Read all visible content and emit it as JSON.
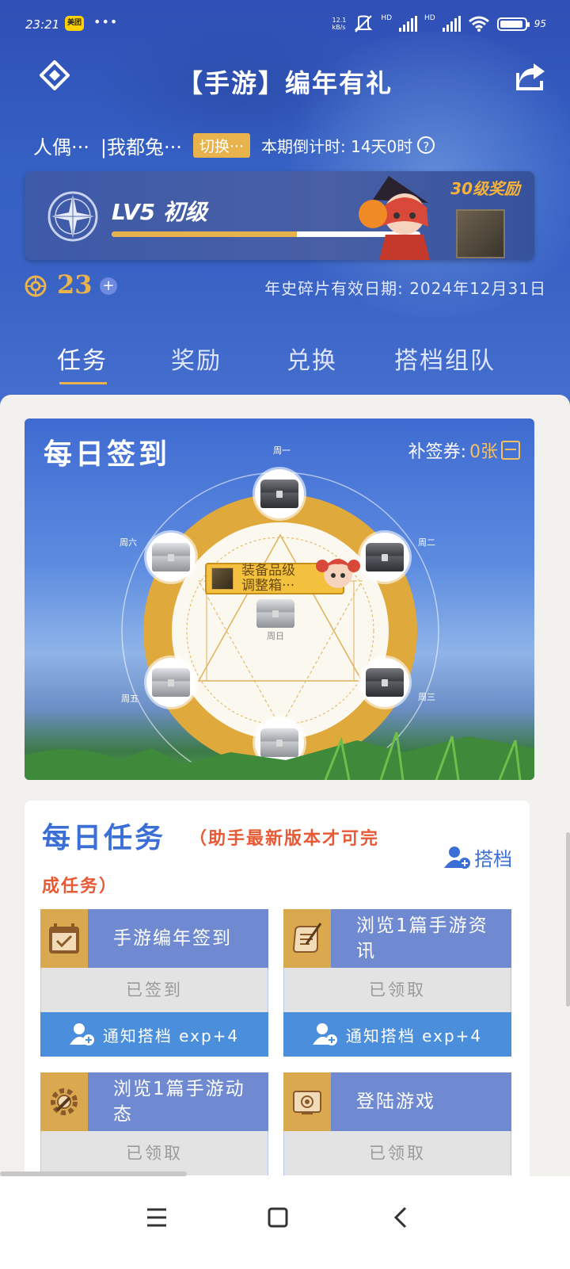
{
  "status_bar": {
    "time": "23:21",
    "app_badge": "美团",
    "dots": "•••",
    "speed": "12.1\nkB/s",
    "sig1": "HD",
    "sig2": "HD",
    "battery": "95"
  },
  "header": {
    "title": "【手游】编年有礼"
  },
  "user": {
    "character": "人偶···",
    "server": "|我都兔···",
    "switch_label": "切换···",
    "countdown": "本期倒计时: 14天0时",
    "help": "?"
  },
  "level": {
    "label": "LV5 初级",
    "progress": 0.6,
    "reward_label": "30级奖励"
  },
  "coins": {
    "count": "23",
    "plus": "+",
    "expiry": "年史碎片有效日期: 2024年12月31日"
  },
  "tabs": [
    "任务",
    "奖励",
    "兑换",
    "搭档组队"
  ],
  "checkin": {
    "title": "每日签到",
    "voucher_label": "补签券:",
    "voucher_count": "0张",
    "days": [
      "周一",
      "周二",
      "周三",
      "周日",
      "周五",
      "周六"
    ],
    "center_day": "周日",
    "tooltip": "装备品级\n调整箱···"
  },
  "daily": {
    "title": "每日任务",
    "note_line1": "（助手最新版本才可完",
    "note_line2": "成任务）",
    "partner_label": "搭档",
    "tasks": [
      {
        "name": "手游编年签到",
        "state": "已签到",
        "notify": "通知搭档 exp+4"
      },
      {
        "name": "浏览1篇手游资讯",
        "state": "已领取",
        "notify": "通知搭档 exp+4"
      },
      {
        "name": "浏览1篇手游动态",
        "state": "已领取"
      },
      {
        "name": "登陆游戏",
        "state": "已领取"
      }
    ]
  },
  "colors": {
    "accent_gold": "#e6b24e",
    "brand_blue": "#3b6fd6",
    "warning_red": "#e75a35"
  }
}
